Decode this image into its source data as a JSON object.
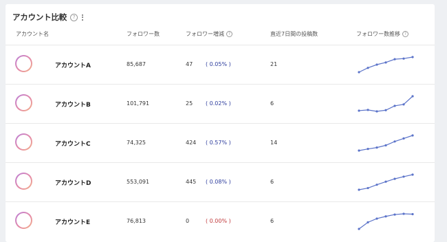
{
  "header": {
    "title": "アカウント比較",
    "help": "?"
  },
  "columns": {
    "name": "アカウント名",
    "followers": "フォロワー数",
    "change": "フォロワー増減",
    "posts": "直近7日間の投稿数",
    "trend": "フォロワー数推移"
  },
  "colors": {
    "sparkline": "#5b73c9",
    "positive": "#2b3b9c",
    "zero": "#c0393b"
  },
  "rows": [
    {
      "name": "アカウントA",
      "followers": "85,687",
      "change": "47",
      "pct": "( 0.05% )",
      "posts": "21",
      "trend": [
        0,
        2,
        3.5,
        4.5,
        6,
        6.3,
        7
      ]
    },
    {
      "name": "アカウントB",
      "followers": "101,791",
      "change": "25",
      "pct": "( 0.02% )",
      "posts": "6",
      "trend": [
        1,
        1.3,
        0.7,
        1.2,
        3,
        3.6,
        7
      ]
    },
    {
      "name": "アカウントC",
      "followers": "74,325",
      "change": "424",
      "pct": "( 0.57% )",
      "posts": "14",
      "trend": [
        0,
        0.8,
        1.5,
        2.6,
        4.5,
        6,
        7.5
      ]
    },
    {
      "name": "アカウントD",
      "followers": "553,091",
      "change": "445",
      "pct": "( 0.08% )",
      "posts": "6",
      "trend": [
        0,
        1,
        3,
        4.8,
        6.5,
        7.8,
        9
      ]
    },
    {
      "name": "アカウントE",
      "followers": "76,813",
      "change": "0",
      "pct": "( 0.00% )",
      "posts": "6",
      "trend": [
        0,
        1.8,
        2.8,
        3.4,
        3.9,
        4.1,
        4
      ]
    }
  ]
}
